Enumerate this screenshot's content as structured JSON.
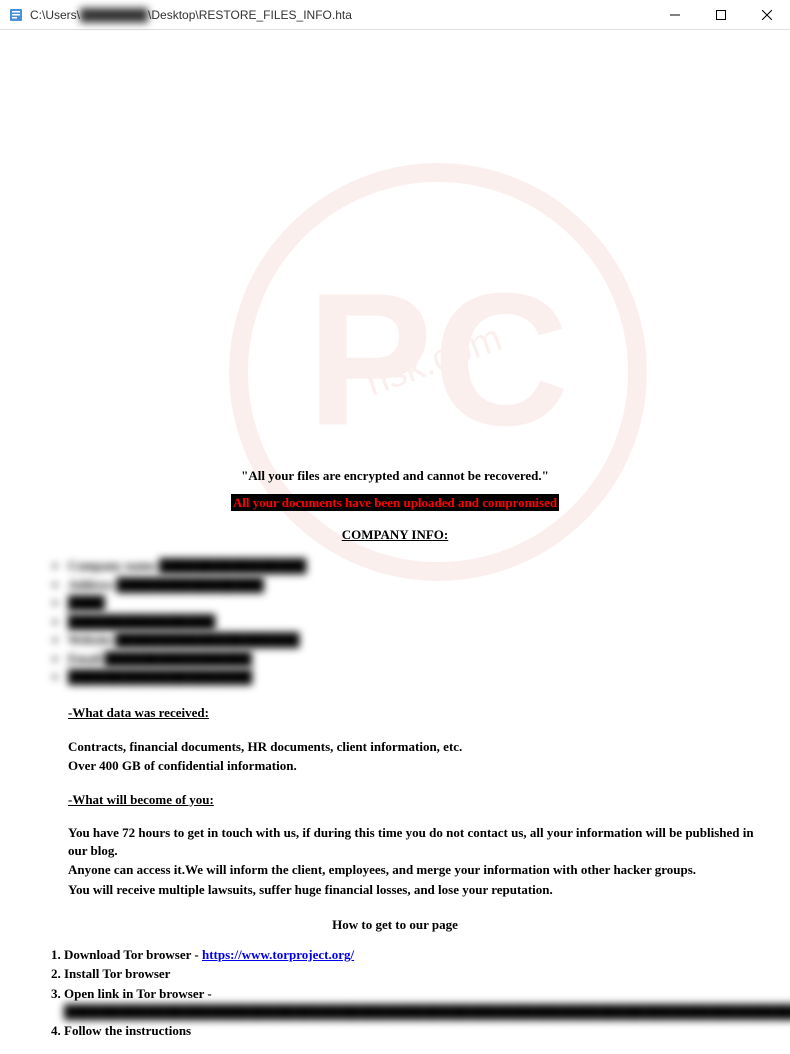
{
  "titlebar": {
    "path_prefix": "C:\\Users\\",
    "path_redacted": "████████",
    "path_suffix": "\\Desktop\\RESTORE_FILES_INFO.hta"
  },
  "headline1": "\"All your files are encrypted and cannot be recovered.\"",
  "headline2": "All your documents have been uploaded and compromised",
  "company_header": "COMPANY INFO:",
  "company_items": [
    "Company name ████████████████",
    "Address ████████████████",
    "████",
    "████████████████",
    "Website ████████████████████",
    "Email ████████████████",
    "████████████████████"
  ],
  "section_received_title": "-What data was received:",
  "received_line1": "Contracts, financial documents, HR documents, client information, etc.",
  "received_line2": "Over 400 GB of confidential information.",
  "section_become_title": "-What will become of you:",
  "become_line1": "You have 72 hours to get in touch with us, if during this time you do not contact us, all your information will be published in our blog.",
  "become_line2": "Anyone can access it.We will inform the client, employees, and merge your information with other hacker groups.",
  "become_line3": "You will receive multiple lawsuits, suffer huge financial losses, and lose your reputation.",
  "howto_header": "How to get to our page",
  "steps": {
    "s1_prefix": "Download Tor browser - ",
    "s1_link": "https://www.torproject.org/",
    "s2": "Install Tor browser",
    "s3_prefix": "Open link in Tor browser - ",
    "s3_redacted": "████████████████████████████████████████████████████████████████████████████████",
    "s4": "Follow the instructions"
  }
}
